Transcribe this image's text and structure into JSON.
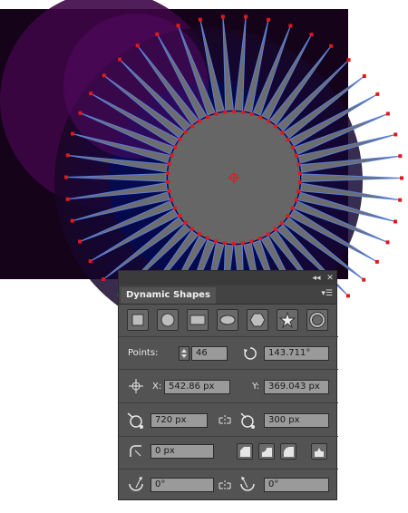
{
  "panel": {
    "title": "Dynamic Shapes",
    "shape_buttons": [
      "square-icon",
      "circle-icon",
      "rounded-rectangle-icon",
      "ellipse-icon",
      "hexagon-icon",
      "star-icon",
      "ring-icon"
    ],
    "points_label": "Points:",
    "points_value": "46",
    "rotation_value": "143.711°",
    "x_label": "X:",
    "x_value": "542.86 px",
    "y_label": "Y:",
    "y_value": "369.043 px",
    "width_value": "720 px",
    "height_value": "300 px",
    "corner_radius_value": "0 px",
    "start_angle_value": "0°",
    "end_angle_value": "0°"
  },
  "colors": {
    "canvas_bg": "#170319",
    "shape_fill": "#666666",
    "spike_stroke": "#5a7fd6",
    "anchor": "#e0191a"
  }
}
